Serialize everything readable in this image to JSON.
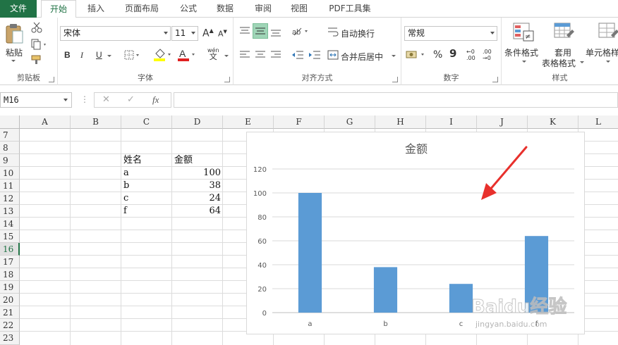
{
  "tabs": [
    {
      "label": "文件"
    },
    {
      "label": "开始"
    },
    {
      "label": "插入"
    },
    {
      "label": "页面布局"
    },
    {
      "label": "公式"
    },
    {
      "label": "数据"
    },
    {
      "label": "审阅"
    },
    {
      "label": "视图"
    },
    {
      "label": "PDF工具集"
    }
  ],
  "ribbon": {
    "clipboard": {
      "paste_label": "粘贴",
      "group_label": "剪贴板"
    },
    "font": {
      "font_name": "宋体",
      "font_size": "11",
      "bold": "B",
      "italic": "I",
      "underline": "U",
      "group_label": "字体",
      "wen_top": "wén",
      "wen_bottom": "文",
      "grow": "A",
      "shrink": "A",
      "font_color_glyph": "A"
    },
    "alignment": {
      "wrap_text": "自动换行",
      "merge_center": "合并后居中",
      "group_label": "对齐方式"
    },
    "number": {
      "format": "常规",
      "percent": "%",
      "comma": "9",
      "group_label": "数字",
      "inc_decimal": "←0 .00",
      "dec_decimal": ".00 →0"
    },
    "styles": {
      "conditional": "条件格式",
      "table_format_1": "套用",
      "table_format_2": "表格格式",
      "cell_styles": "单元格样",
      "group_label": "样式"
    }
  },
  "formula_bar": {
    "name_box": "M16",
    "cancel": "✕",
    "enter": "✓",
    "fx": "fx",
    "formula": ""
  },
  "columns": [
    "A",
    "B",
    "C",
    "D",
    "E",
    "F",
    "G",
    "H",
    "I",
    "J",
    "K",
    "L"
  ],
  "rows": [
    "7",
    "8",
    "9",
    "10",
    "11",
    "12",
    "13",
    "14",
    "15",
    "16",
    "17",
    "18",
    "19",
    "20",
    "21",
    "22",
    "23"
  ],
  "selected_row": "16",
  "cells": {
    "header": {
      "name": "姓名",
      "amount": "金额"
    },
    "data": [
      {
        "name": "a",
        "amount": "100"
      },
      {
        "name": "b",
        "amount": "38"
      },
      {
        "name": "c",
        "amount": "24"
      },
      {
        "name": "f",
        "amount": "64"
      }
    ]
  },
  "colors": {
    "accent": "#217346",
    "bar": "#5b9bd5",
    "arrow": "#e8302c"
  },
  "chart_data": {
    "type": "bar",
    "title": "金额",
    "categories": [
      "a",
      "b",
      "c",
      "f"
    ],
    "values": [
      100,
      38,
      24,
      64
    ],
    "xlabel": "",
    "ylabel": "",
    "ylim": [
      0,
      120
    ],
    "yticks": [
      0,
      20,
      40,
      60,
      80,
      100,
      120
    ],
    "grid": true,
    "legend": "none"
  },
  "watermark": {
    "brand": "Baidu经验",
    "url": "jingyan.baidu.com"
  }
}
